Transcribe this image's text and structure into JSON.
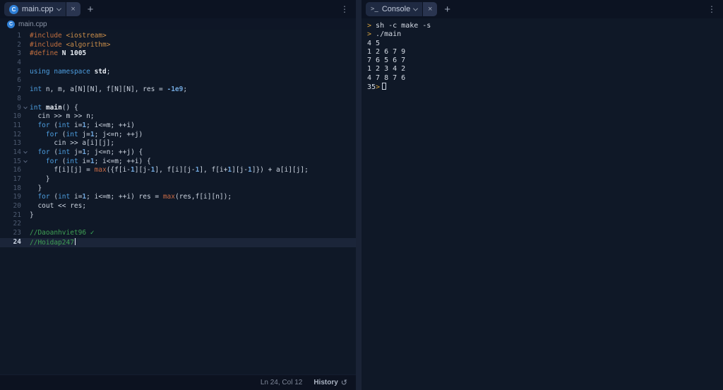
{
  "colors": {
    "keyword": "#4d9ee0",
    "preprocessor": "#c4703f",
    "include_path": "#cc8f4a",
    "function_call": "#c96a45",
    "number": "#71a7dd",
    "comment": "#3fa054",
    "console_prompt": "#d7a33e",
    "cpp_icon_bg": "#2f7fd6",
    "active_line_bg": "#1b2539"
  },
  "editor": {
    "tab": {
      "label": "main.cpp",
      "close_glyph": "×"
    },
    "new_tab_glyph": "+",
    "menu_glyph": "⋮",
    "breadcrumb": {
      "label": "main.cpp"
    },
    "cpp_icon_letter": "C",
    "status": {
      "cursor_position": "Ln 24, Col 12",
      "history_label": "History",
      "history_icon_glyph": "↺"
    },
    "code_lines": [
      {
        "num": "1",
        "tokens": [
          {
            "c": "pre",
            "t": "#include"
          },
          {
            "c": "txt",
            "t": " "
          },
          {
            "c": "str",
            "t": "<iostream>"
          }
        ]
      },
      {
        "num": "2",
        "tokens": [
          {
            "c": "pre",
            "t": "#include"
          },
          {
            "c": "txt",
            "t": " "
          },
          {
            "c": "str",
            "t": "<algorithm>"
          }
        ]
      },
      {
        "num": "3",
        "tokens": [
          {
            "c": "pre",
            "t": "#define"
          },
          {
            "c": "txt",
            "t": " "
          },
          {
            "c": "def",
            "t": "N"
          },
          {
            "c": "txt",
            "t": " "
          },
          {
            "c": "def",
            "t": "1005"
          }
        ]
      },
      {
        "num": "4",
        "tokens": []
      },
      {
        "num": "5",
        "tokens": [
          {
            "c": "kw",
            "t": "using"
          },
          {
            "c": "txt",
            "t": " "
          },
          {
            "c": "kw",
            "t": "namespace"
          },
          {
            "c": "txt",
            "t": " "
          },
          {
            "c": "def",
            "t": "std"
          },
          {
            "c": "txt",
            "t": ";"
          }
        ]
      },
      {
        "num": "6",
        "tokens": []
      },
      {
        "num": "7",
        "tokens": [
          {
            "c": "kw",
            "t": "int"
          },
          {
            "c": "txt",
            "t": " n, m, a[N][N], f[N][N], res = "
          },
          {
            "c": "num",
            "t": "-1e9"
          },
          {
            "c": "txt",
            "t": ";"
          }
        ]
      },
      {
        "num": "8",
        "tokens": []
      },
      {
        "num": "9",
        "fold": true,
        "tokens": [
          {
            "c": "kw",
            "t": "int"
          },
          {
            "c": "txt",
            "t": " "
          },
          {
            "c": "def",
            "t": "main"
          },
          {
            "c": "txt",
            "t": "() {"
          }
        ]
      },
      {
        "num": "10",
        "tokens": [
          {
            "c": "txt",
            "t": "  cin >> m >> n;"
          }
        ]
      },
      {
        "num": "11",
        "tokens": [
          {
            "c": "txt",
            "t": "  "
          },
          {
            "c": "kw",
            "t": "for"
          },
          {
            "c": "txt",
            "t": " ("
          },
          {
            "c": "kw",
            "t": "int"
          },
          {
            "c": "txt",
            "t": " i="
          },
          {
            "c": "num",
            "t": "1"
          },
          {
            "c": "txt",
            "t": "; i<=m; ++i)"
          }
        ]
      },
      {
        "num": "12",
        "tokens": [
          {
            "c": "txt",
            "t": "    "
          },
          {
            "c": "kw",
            "t": "for"
          },
          {
            "c": "txt",
            "t": " ("
          },
          {
            "c": "kw",
            "t": "int"
          },
          {
            "c": "txt",
            "t": " j="
          },
          {
            "c": "num",
            "t": "1"
          },
          {
            "c": "txt",
            "t": "; j<=n; ++j)"
          }
        ]
      },
      {
        "num": "13",
        "tokens": [
          {
            "c": "txt",
            "t": "      cin >> a[i][j];"
          }
        ]
      },
      {
        "num": "14",
        "fold": true,
        "tokens": [
          {
            "c": "txt",
            "t": "  "
          },
          {
            "c": "kw",
            "t": "for"
          },
          {
            "c": "txt",
            "t": " ("
          },
          {
            "c": "kw",
            "t": "int"
          },
          {
            "c": "txt",
            "t": " j="
          },
          {
            "c": "num",
            "t": "1"
          },
          {
            "c": "txt",
            "t": "; j<=n; ++j) {"
          }
        ]
      },
      {
        "num": "15",
        "fold": true,
        "tokens": [
          {
            "c": "txt",
            "t": "    "
          },
          {
            "c": "kw",
            "t": "for"
          },
          {
            "c": "txt",
            "t": " ("
          },
          {
            "c": "kw",
            "t": "int"
          },
          {
            "c": "txt",
            "t": " i="
          },
          {
            "c": "num",
            "t": "1"
          },
          {
            "c": "txt",
            "t": "; i<=m; ++i) {"
          }
        ]
      },
      {
        "num": "16",
        "tokens": [
          {
            "c": "txt",
            "t": "      f[i][j] = "
          },
          {
            "c": "fn",
            "t": "max"
          },
          {
            "c": "txt",
            "t": "({f[i-"
          },
          {
            "c": "num",
            "t": "1"
          },
          {
            "c": "txt",
            "t": "][j-"
          },
          {
            "c": "num",
            "t": "1"
          },
          {
            "c": "txt",
            "t": "], f[i][j-"
          },
          {
            "c": "num",
            "t": "1"
          },
          {
            "c": "txt",
            "t": "], f[i+"
          },
          {
            "c": "num",
            "t": "1"
          },
          {
            "c": "txt",
            "t": "][j-"
          },
          {
            "c": "num",
            "t": "1"
          },
          {
            "c": "txt",
            "t": "]}) + a[i][j];"
          }
        ]
      },
      {
        "num": "17",
        "tokens": [
          {
            "c": "txt",
            "t": "    }"
          }
        ]
      },
      {
        "num": "18",
        "tokens": [
          {
            "c": "txt",
            "t": "  }"
          }
        ]
      },
      {
        "num": "19",
        "tokens": [
          {
            "c": "txt",
            "t": "  "
          },
          {
            "c": "kw",
            "t": "for"
          },
          {
            "c": "txt",
            "t": " ("
          },
          {
            "c": "kw",
            "t": "int"
          },
          {
            "c": "txt",
            "t": " i="
          },
          {
            "c": "num",
            "t": "1"
          },
          {
            "c": "txt",
            "t": "; i<=m; ++i) res = "
          },
          {
            "c": "fn",
            "t": "max"
          },
          {
            "c": "txt",
            "t": "(res,f[i][n]);"
          }
        ]
      },
      {
        "num": "20",
        "tokens": [
          {
            "c": "txt",
            "t": "  cout << res;"
          }
        ]
      },
      {
        "num": "21",
        "tokens": [
          {
            "c": "txt",
            "t": "}"
          }
        ]
      },
      {
        "num": "22",
        "tokens": []
      },
      {
        "num": "23",
        "tokens": [
          {
            "c": "com",
            "t": "//Daoanhviet96 "
          },
          {
            "c": "chk",
            "t": "✓"
          }
        ]
      },
      {
        "num": "24",
        "active": true,
        "caret": true,
        "tokens": [
          {
            "c": "com",
            "t": "//Hoidap247"
          }
        ]
      }
    ]
  },
  "console": {
    "tab": {
      "label": "Console",
      "icon_glyph": ">_",
      "close_glyph": "×"
    },
    "new_tab_glyph": "+",
    "menu_glyph": "⋮",
    "prompt_glyph": ">",
    "lines": [
      {
        "prompt": true,
        "text": "sh -c make -s"
      },
      {
        "prompt": true,
        "text": "./main"
      },
      {
        "prompt": false,
        "text": "4 5"
      },
      {
        "prompt": false,
        "text": "1 2 6 7 9"
      },
      {
        "prompt": false,
        "text": "7 6 5 6 7"
      },
      {
        "prompt": false,
        "text": "1 2 3 4 2"
      },
      {
        "prompt": false,
        "text": "4 7 8 7 6"
      },
      {
        "prompt": false,
        "text": "35",
        "prompt_after": true,
        "cursor": true
      }
    ]
  }
}
